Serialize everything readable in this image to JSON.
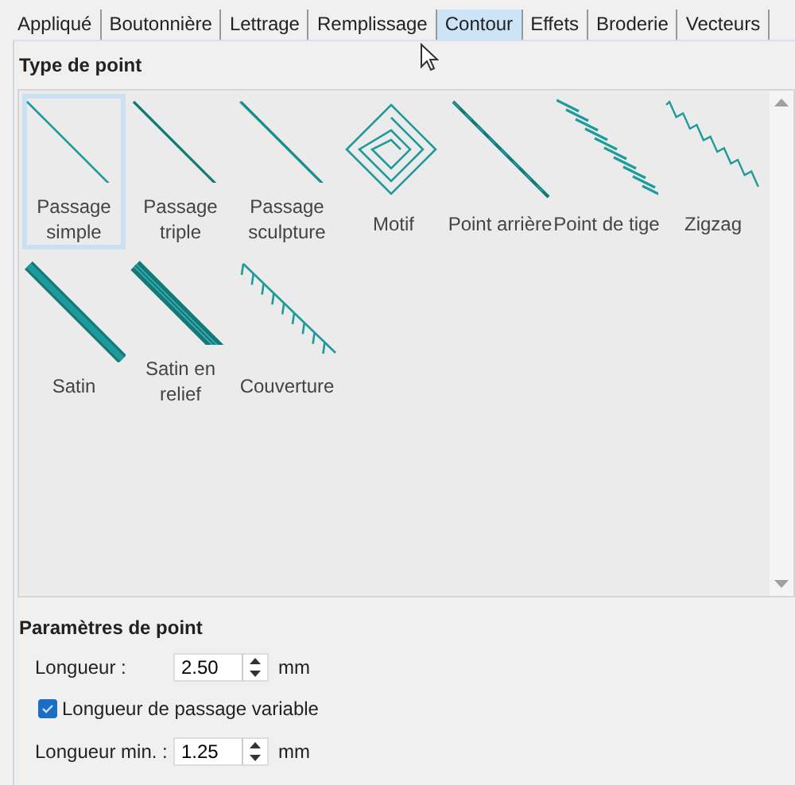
{
  "tabs": [
    {
      "label": "Appliqué",
      "selected": false
    },
    {
      "label": "Boutonnière",
      "selected": false
    },
    {
      "label": "Lettrage",
      "selected": false
    },
    {
      "label": "Remplissage",
      "selected": false
    },
    {
      "label": "Contour",
      "selected": true
    },
    {
      "label": "Effets",
      "selected": false
    },
    {
      "label": "Broderie",
      "selected": false
    },
    {
      "label": "Vecteurs",
      "selected": false
    }
  ],
  "stitch_type": {
    "title": "Type de point",
    "items": [
      {
        "label": "Passage simple",
        "kind": "single",
        "selected": true
      },
      {
        "label": "Passage triple",
        "kind": "triple",
        "selected": false
      },
      {
        "label": "Passage sculpture",
        "kind": "sculpture",
        "selected": false
      },
      {
        "label": "Motif",
        "kind": "motif",
        "selected": false
      },
      {
        "label": "Point arrière",
        "kind": "backstitch",
        "selected": false
      },
      {
        "label": "Point de tige",
        "kind": "stem",
        "selected": false
      },
      {
        "label": "Zigzag",
        "kind": "zigzag",
        "selected": false
      },
      {
        "label": "Satin",
        "kind": "satin",
        "selected": false
      },
      {
        "label": "Satin en relief",
        "kind": "raised",
        "selected": false
      },
      {
        "label": "Couverture",
        "kind": "blanket",
        "selected": false
      }
    ]
  },
  "stitch_params": {
    "title": "Paramètres de point",
    "length": {
      "label": "Longueur :",
      "value": "2.50",
      "unit": "mm"
    },
    "variable": {
      "label": "Longueur de passage variable",
      "checked": true
    },
    "min_length": {
      "label": "Longueur min. :",
      "value": "1.25",
      "unit": "mm"
    }
  }
}
